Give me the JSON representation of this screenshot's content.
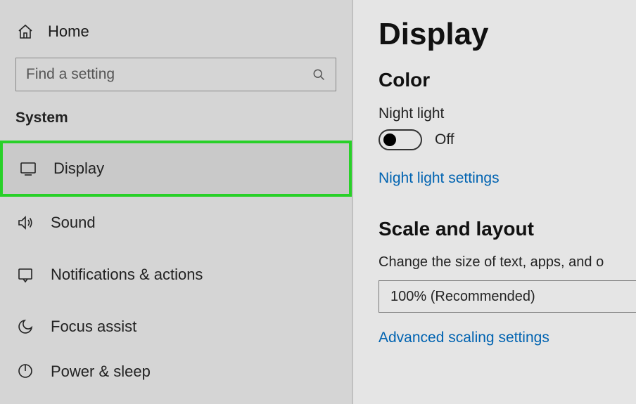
{
  "sidebar": {
    "home_label": "Home",
    "search_placeholder": "Find a setting",
    "section_label": "System",
    "items": [
      {
        "label": "Display"
      },
      {
        "label": "Sound"
      },
      {
        "label": "Notifications & actions"
      },
      {
        "label": "Focus assist"
      },
      {
        "label": "Power & sleep"
      }
    ]
  },
  "main": {
    "title": "Display",
    "color_section": "Color",
    "night_light_label": "Night light",
    "night_light_state": "Off",
    "night_light_link": "Night light settings",
    "scale_section": "Scale and layout",
    "scale_desc": "Change the size of text, apps, and o",
    "scale_value": "100% (Recommended)",
    "advanced_scaling_link": "Advanced scaling settings"
  }
}
